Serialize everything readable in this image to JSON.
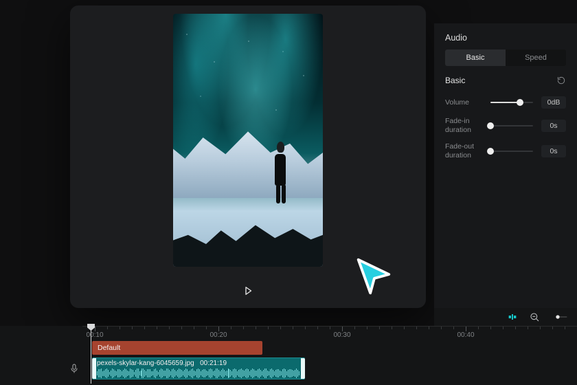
{
  "preview": {
    "play_label": "Play"
  },
  "audio": {
    "title": "Audio",
    "tabs": {
      "basic": "Basic",
      "speed": "Speed"
    },
    "active_tab": "basic",
    "section_label": "Basic",
    "volume": {
      "label": "Volume",
      "value": "0dB",
      "pct": 70
    },
    "fade_in": {
      "label": "Fade-in duration",
      "value": "0s",
      "pct": 0
    },
    "fade_out": {
      "label": "Fade-out duration",
      "value": "0s",
      "pct": 0
    }
  },
  "timeline": {
    "ticks": [
      "00:10",
      "00:20",
      "00:30",
      "00:40"
    ],
    "default_clip_label": "Default",
    "media_clip": {
      "filename": "pexels-skylar-kang-6045659.jpg",
      "duration": "00:21:19"
    }
  },
  "colors": {
    "teal": "#17c7c9",
    "clip_orange": "#a6432f",
    "clip_teal": "#0b6a6d"
  }
}
